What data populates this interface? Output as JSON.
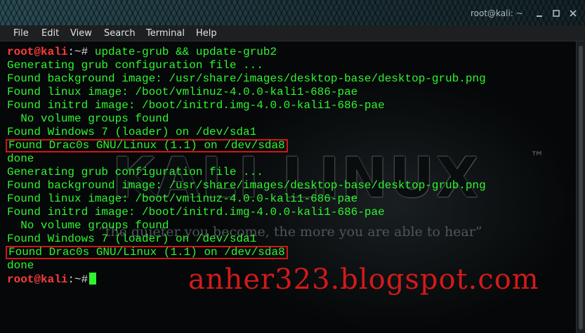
{
  "window": {
    "title": "root@kali: ~"
  },
  "menubar": {
    "items": [
      "File",
      "Edit",
      "View",
      "Search",
      "Terminal",
      "Help"
    ]
  },
  "prompt": {
    "user_host": "root@kali",
    "separator": ":",
    "path": "~",
    "symbol": "#"
  },
  "command": " update-grub && update-grub2",
  "output_lines": [
    "Generating grub configuration file ...",
    "Found background image: /usr/share/images/desktop-base/desktop-grub.png",
    "Found linux image: /boot/vmlinuz-4.0.0-kali1-686-pae",
    "Found initrd image: /boot/initrd.img-4.0.0-kali1-686-pae",
    "  No volume groups found",
    "Found Windows 7 (loader) on /dev/sda1",
    "Found Drac0s GNU/Linux (1.1) on /dev/sda8",
    "done",
    "Generating grub configuration file ...",
    "Found background image: /usr/share/images/desktop-base/desktop-grub.png",
    "Found linux image: /boot/vmlinuz-4.0.0-kali1-686-pae",
    "Found initrd image: /boot/initrd.img-4.0.0-kali1-686-pae",
    "  No volume groups found",
    "Found Windows 7 (loader) on /dev/sda1",
    "Found Drac0s GNU/Linux (1.1) on /dev/sda8",
    "done"
  ],
  "highlighted_line_indices": [
    6,
    14
  ],
  "background": {
    "logo_text": "KALI LINUX",
    "trademark": "™",
    "quote": "“the quieter you become, the more you are able to hear”"
  },
  "watermark": {
    "text": "anher323.blogspot.com"
  },
  "colors": {
    "terminal_text": "#2ff52f",
    "prompt_user": "#ff3b3b",
    "highlight_border": "#d01515",
    "watermark": "#d31a1a"
  },
  "icons": {
    "minimize": "minimize-icon",
    "maximize": "maximize-icon",
    "close": "close-icon"
  }
}
